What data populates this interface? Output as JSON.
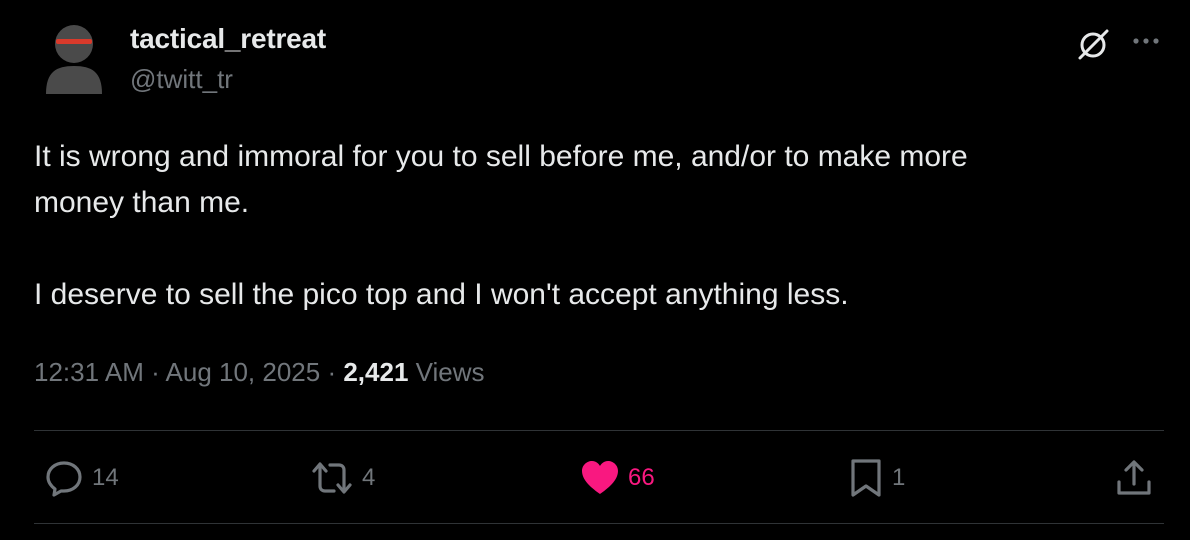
{
  "author": {
    "name": "tactical_retreat",
    "handle": "@twitt_tr",
    "avatar_icon": "hooded-figure-avatar-icon"
  },
  "header_icons": {
    "grok": "grok-slash-circle-icon",
    "more": "more-horizontal-icon"
  },
  "tweet": {
    "text": "It is wrong and immoral for you to sell before me, and/or to make more\nmoney than me.\n\nI deserve to sell the pico top and I won't accept anything less."
  },
  "meta": {
    "time": "12:31 AM",
    "separator": " · ",
    "date": "Aug 10, 2025",
    "views_count": "2,421",
    "views_label": "Views"
  },
  "actions": {
    "reply": {
      "icon": "reply-bubble-icon",
      "count": "14"
    },
    "repost": {
      "icon": "repost-arrows-icon",
      "count": "4"
    },
    "like": {
      "icon": "heart-filled-icon",
      "count": "66",
      "liked": true
    },
    "bookmark": {
      "icon": "bookmark-icon",
      "count": "1"
    },
    "share": {
      "icon": "share-upload-icon"
    }
  },
  "colors": {
    "background": "#000000",
    "text_primary": "#e7e9ea",
    "text_secondary": "#71767b",
    "like_active": "#f91880",
    "divider": "#2f3336"
  }
}
